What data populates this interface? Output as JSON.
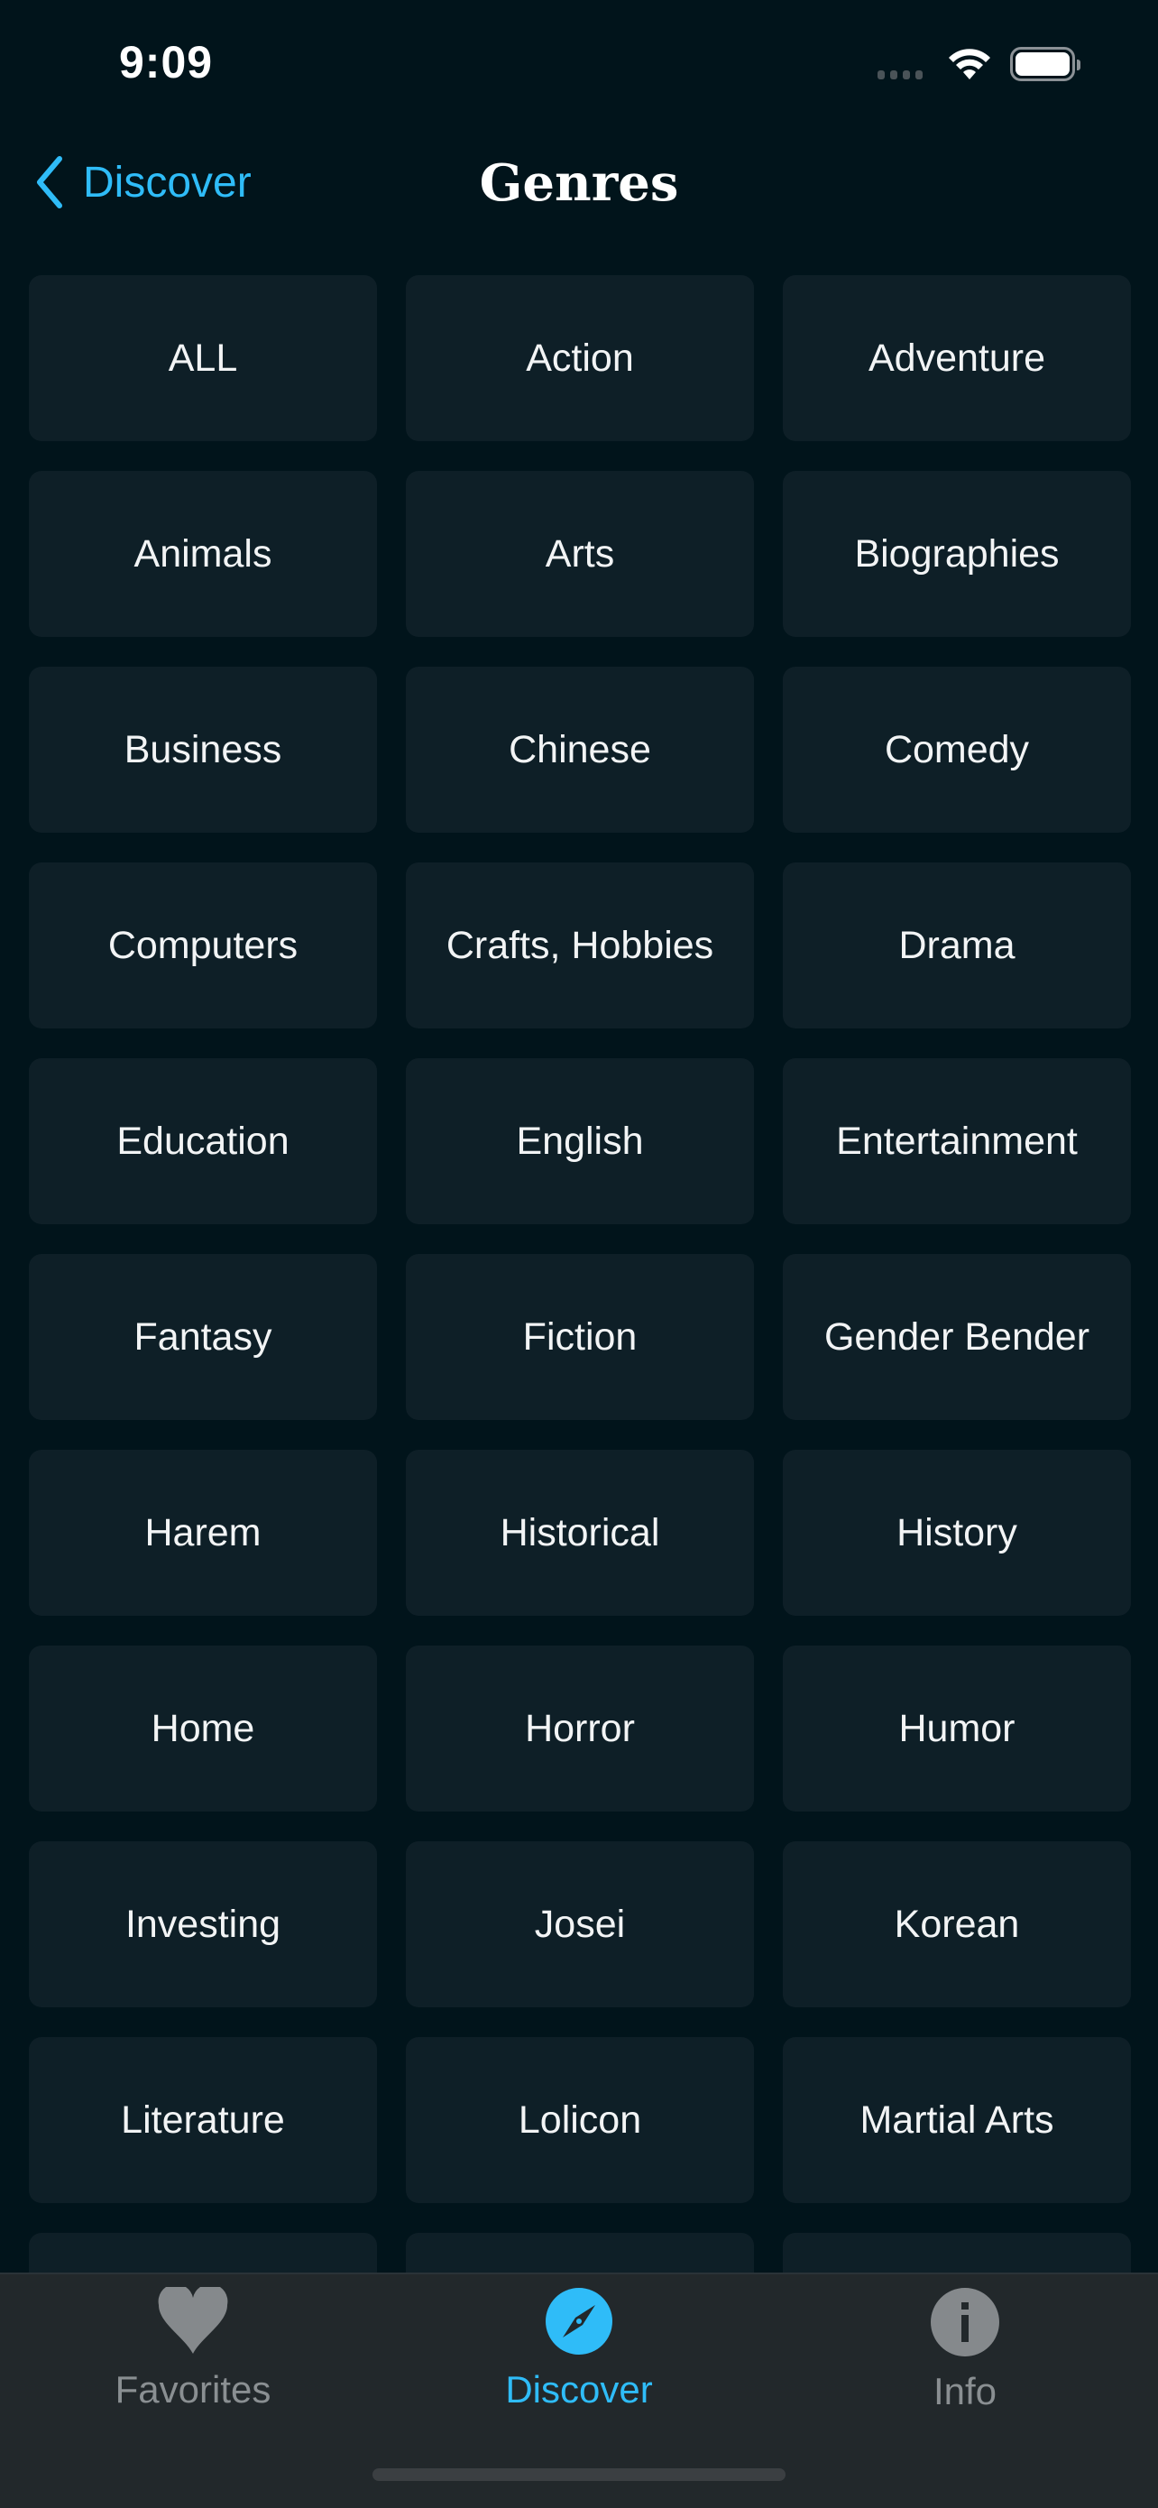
{
  "status": {
    "time": "9:09"
  },
  "nav": {
    "back_label": "Discover",
    "title": "Genres"
  },
  "genres": [
    "ALL",
    "Action",
    "Adventure",
    "Animals",
    "Arts",
    "Biographies",
    "Business",
    "Chinese",
    "Comedy",
    "Computers",
    "Crafts, Hobbies",
    "Drama",
    "Education",
    "English",
    "Entertainment",
    "Fantasy",
    "Fiction",
    "Gender Bender",
    "Harem",
    "Historical",
    "History",
    "Home",
    "Horror",
    "Humor",
    "Investing",
    "Josei",
    "Korean",
    "Literature",
    "Lolicon",
    "Martial Arts",
    "",
    "",
    ""
  ],
  "tabs": [
    {
      "label": "Favorites",
      "icon": "heart-icon",
      "active": false
    },
    {
      "label": "Discover",
      "icon": "compass-icon",
      "active": true
    },
    {
      "label": "Info",
      "icon": "info-icon",
      "active": false
    }
  ],
  "colors": {
    "accent": "#2fbcf8",
    "background": "#01141b",
    "tile": "#0e1f27",
    "tabbar": "#22282b"
  }
}
